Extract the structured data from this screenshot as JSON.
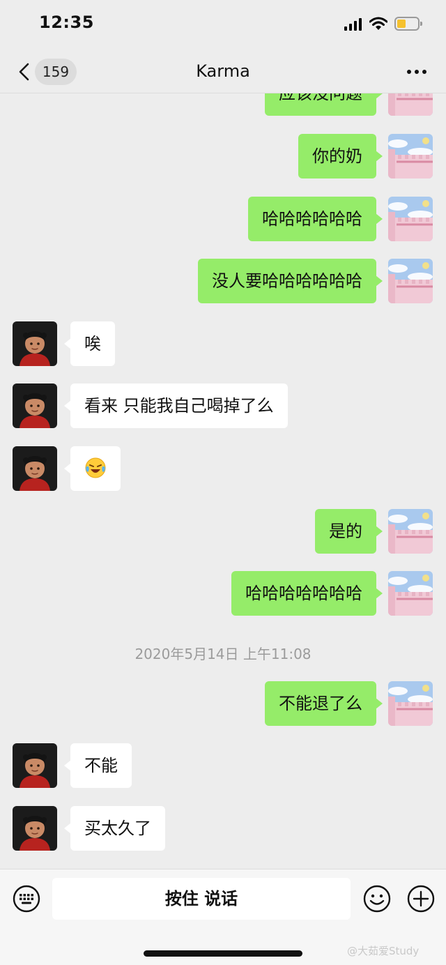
{
  "status_bar": {
    "time": "12:35"
  },
  "nav": {
    "unread_count": "159",
    "title": "Karma"
  },
  "messages": [
    {
      "side": "out",
      "text": "应该没问题"
    },
    {
      "side": "out",
      "text": "你的奶"
    },
    {
      "side": "out",
      "text": "哈哈哈哈哈哈"
    },
    {
      "side": "out",
      "text": "没人要哈哈哈哈哈哈"
    },
    {
      "side": "in",
      "text": "唉"
    },
    {
      "side": "in",
      "text": "看来 只能我自己喝掉了么"
    },
    {
      "side": "in",
      "emoji": "laughing-crying-emoji"
    },
    {
      "side": "out",
      "text": "是的"
    },
    {
      "side": "out",
      "text": "哈哈哈哈哈哈哈"
    },
    {
      "timestamp": "2020年5月14日 上午11:08"
    },
    {
      "side": "out",
      "text": "不能退了么"
    },
    {
      "side": "in",
      "text": "不能"
    },
    {
      "side": "in",
      "text": "买太久了"
    }
  ],
  "input_bar": {
    "voice_label": "按住 说话"
  },
  "watermark": "@大茹爱Study",
  "colors": {
    "outgoing_bubble": "#95ec69",
    "incoming_bubble": "#ffffff",
    "background": "#ededed"
  }
}
